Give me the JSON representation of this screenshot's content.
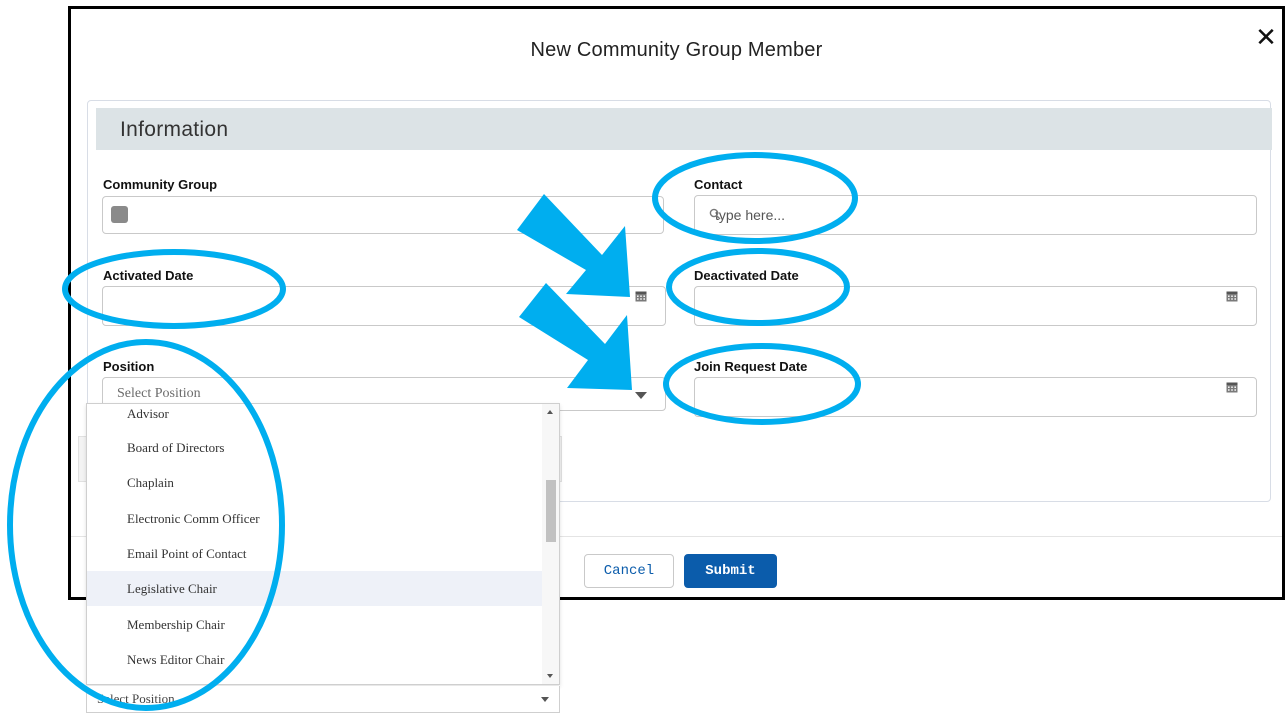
{
  "modal": {
    "title": "New Community Group Member",
    "close_symbol": "✕"
  },
  "section": {
    "title": "Information"
  },
  "fields": {
    "community_group": {
      "label": "Community Group",
      "value": ""
    },
    "contact": {
      "label": "Contact",
      "placeholder": "type here..."
    },
    "activated_date": {
      "label": "Activated Date",
      "value": ""
    },
    "deactivated_date": {
      "label": "Deactivated Date",
      "value": ""
    },
    "position": {
      "label": "Position",
      "placeholder": "Select Position"
    },
    "join_request_date": {
      "label": "Join Request Date",
      "value": ""
    }
  },
  "footer": {
    "cancel_label": "Cancel",
    "submit_label": "Submit"
  },
  "dropdown": {
    "options": [
      "Advisor",
      "Board of Directors",
      "Chaplain",
      "Electronic Comm Officer",
      "Email Point of Contact",
      "Legislative Chair",
      "Membership Chair",
      "News Editor Chair"
    ],
    "hovered": "Legislative Chair",
    "bottom_placeholder": "Select Position"
  },
  "colors": {
    "brand": "#0b5cab",
    "section_header_bg": "#dce3e6",
    "annotation": "#00aeef"
  }
}
